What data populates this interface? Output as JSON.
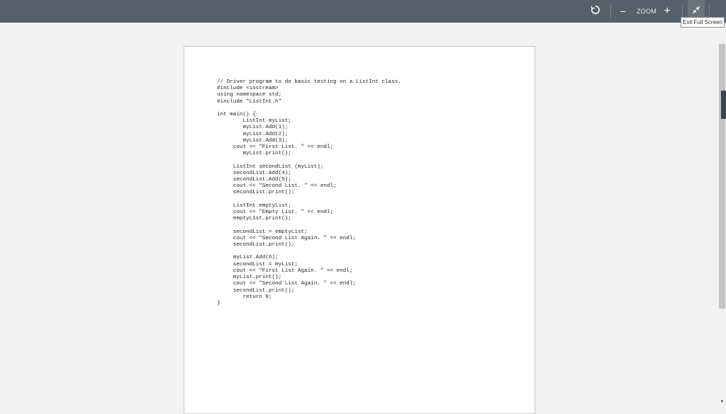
{
  "toolbar": {
    "zoom_label": "ZOOM",
    "zoom_out_glyph": "−",
    "zoom_in_glyph": "+",
    "tooltip": "Exit Full Screen",
    "icons": {
      "rotate": "rotate-icon",
      "zoom_out": "minus-icon",
      "zoom_in": "plus-icon",
      "exit_fullscreen": "exit-fullscreen-icon"
    }
  },
  "document": {
    "code": "// Driver program to do basic testing on a ListInt class.\n#include <iostream>\nusing namespace std;\n#include \"ListInt.h\"\n\nint main() {\n        ListInt myList;\n        myList.Add(1);\n        myList.Add(2);\n        myList.Add(3);\n     cout << \"First List. \" << endl;\n        myList.print();\n\n     ListInt secondList (myList);\n     secondList.Add(4);\n     secondList.Add(5);\n     cout << \"Second List. \" << endl;\n     secondList.print();\n\n     ListInt emptyList;\n     cout << \"Empty List. \" << endl;\n     emptyList.print();\n\n     secondList = emptyList;\n     cout << \"Second List Again. \" << endl;\n     secondList.print();\n\n     myList.Add(6);\n     secondList = myList;\n     cout << \"First List Again. \" << endl;\n     myList.print();\n     cout << \"Second List Again. \" << endl;\n     secondList.print();\n        return 0;\n}"
  },
  "colors": {
    "toolbar_bg": "#56606b",
    "canvas_bg": "#f2f2f2",
    "page_bg": "#ffffff"
  }
}
